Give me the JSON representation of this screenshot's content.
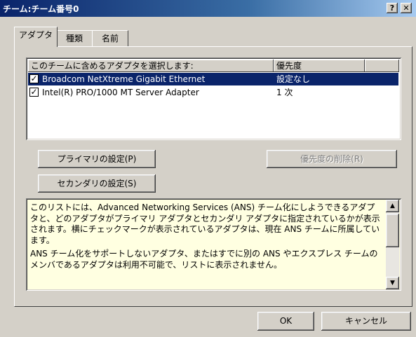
{
  "window": {
    "title": "チーム:チーム番号0",
    "help_btn": "?",
    "close_btn": "✕"
  },
  "tabs": [
    {
      "label": "アダプタ",
      "active": true
    },
    {
      "label": "種類",
      "active": false
    },
    {
      "label": "名前",
      "active": false
    }
  ],
  "adapter_list": {
    "col_adapter": "このチームに含めるアダプタを選択します:",
    "col_priority": "優先度",
    "rows": [
      {
        "checked": true,
        "name": "Broadcom NetXtreme Gigabit Ethernet",
        "priority": "設定なし",
        "selected": true
      },
      {
        "checked": true,
        "name": "Intel(R) PRO/1000 MT Server Adapter",
        "priority": "1 次",
        "selected": false
      }
    ]
  },
  "buttons": {
    "set_primary": "プライマリの設定(P)",
    "set_secondary": "セカンダリの設定(S)",
    "remove_priority": "優先度の削除(R)",
    "ok": "OK",
    "cancel": "キャンセル"
  },
  "info": {
    "para1": "このリストには、Advanced Networking Services (ANS) チーム化にしようできるアダプタと、どのアダプタがプライマリ アダプタとセカンダリ アダプタに指定されているかが表示されます。横にチェックマークが表示されているアダプタは、現在 ANS チームに所属しています。",
    "para2": "ANS チーム化をサポートしないアダプタ、またはすでに別の ANS やエクスプレス チームのメンバであるアダプタは利用不可能で、リストに表示されません。"
  },
  "colors": {
    "titlebar_start": "#0a246a",
    "titlebar_end": "#a6caf0",
    "selection": "#0a246a",
    "info_background": "#ffffe1",
    "face": "#d4d0c8"
  }
}
